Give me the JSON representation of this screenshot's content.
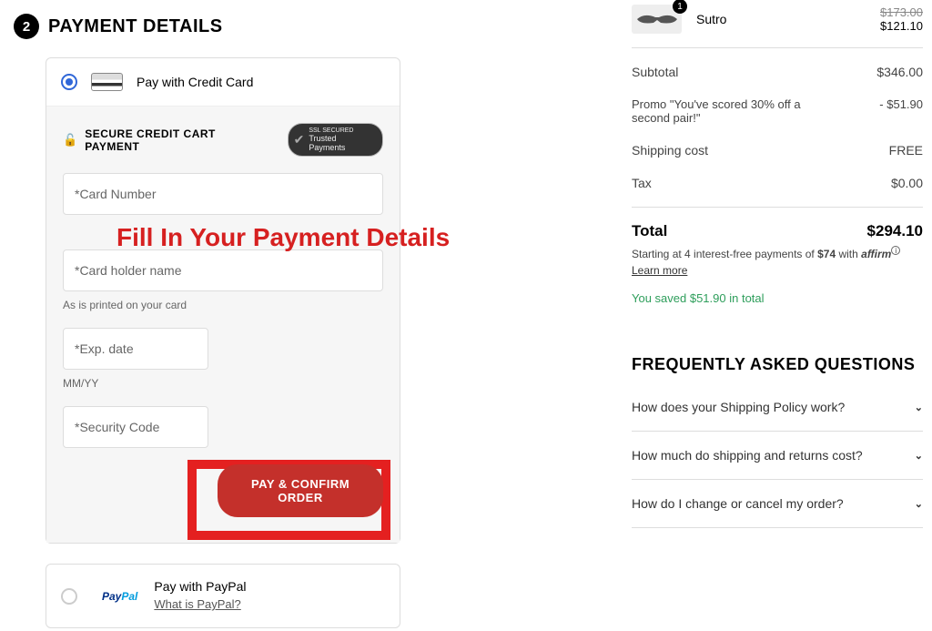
{
  "header": {
    "step": "2",
    "title": "PAYMENT DETAILS"
  },
  "overlay": "Fill In Your Payment Details",
  "credit_card": {
    "method_label": "Pay with Credit Card",
    "secure_text": "SECURE CREDIT CART PAYMENT",
    "badge_small": "SSL SECURED",
    "badge_main": "Trusted Payments",
    "card_number_ph": "*Card Number",
    "holder_ph": "*Card holder name",
    "holder_hint": "As is printed on your card",
    "exp_ph": "*Exp. date",
    "exp_hint": "MM/YY",
    "cvv_ph": "*Security Code",
    "submit": "PAY & CONFIRM ORDER"
  },
  "paypal": {
    "label": "Pay with PayPal",
    "link": "What is PayPal?"
  },
  "cart": {
    "item": {
      "qty": "1",
      "name": "Sutro",
      "old": "$173.00",
      "now": "$121.10"
    }
  },
  "summary": {
    "subtotal_label": "Subtotal",
    "subtotal": "$346.00",
    "promo_label": "Promo \"You've scored 30% off a second pair!\"",
    "promo": "- $51.90",
    "ship_label": "Shipping cost",
    "ship": "FREE",
    "tax_label": "Tax",
    "tax": "$0.00",
    "total_label": "Total",
    "total": "$294.10",
    "affirm_pre": "Starting at 4 interest-free payments of ",
    "affirm_amount": "$74",
    "affirm_with": " with ",
    "affirm_brand": "affirm",
    "learn": "Learn more",
    "saved": "You saved $51.90 in total"
  },
  "faq": {
    "title": "FREQUENTLY ASKED QUESTIONS",
    "q1": "How does your Shipping Policy work?",
    "q2": "How much do shipping and returns cost?",
    "q3": "How do I change or cancel my order?"
  }
}
